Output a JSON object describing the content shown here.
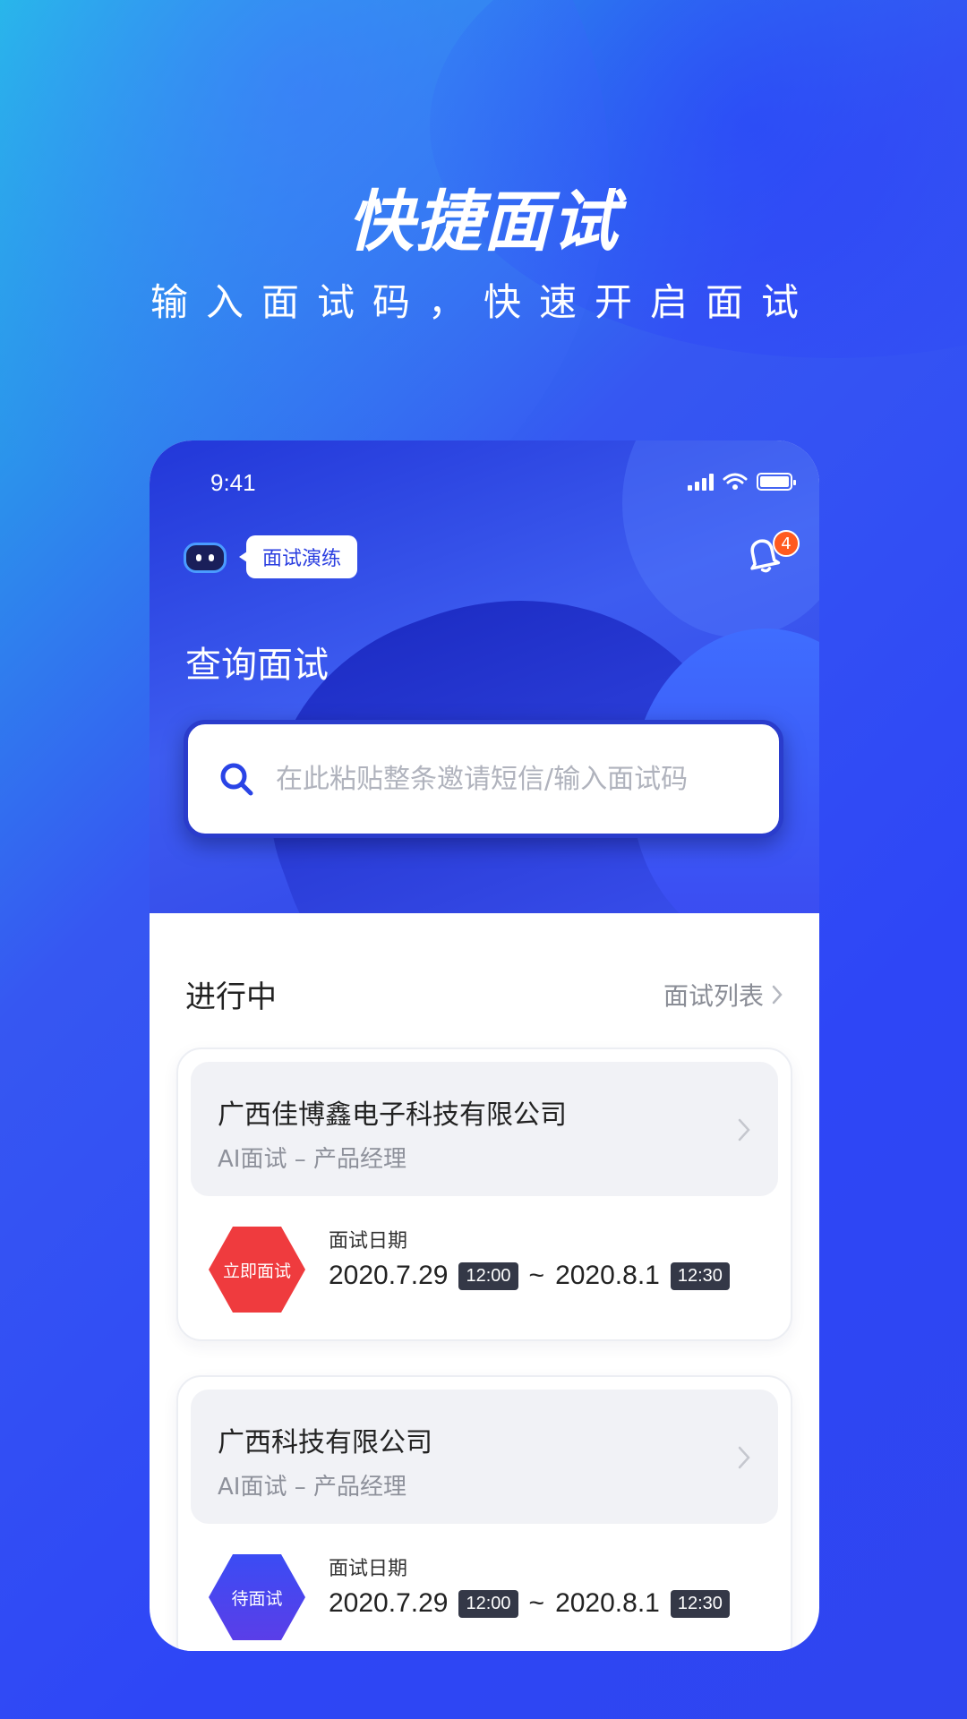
{
  "hero": {
    "title": "快捷面试",
    "subtitle": "输入面试码，快速开启面试"
  },
  "status_bar": {
    "time": "9:41"
  },
  "header": {
    "practice_label": "面试演练",
    "notification_count": "4",
    "query_title": "查询面试"
  },
  "search": {
    "placeholder": "在此粘贴整条邀请短信/输入面试码"
  },
  "section": {
    "title": "进行中",
    "list_link": "面试列表"
  },
  "cards": [
    {
      "company": "广西佳博鑫电子科技有限公司",
      "role": "AI面试 – 产品经理",
      "status": "立即面试",
      "date_label": "面试日期",
      "start_date": "2020.7.29",
      "start_time": "12:00",
      "separator": "~",
      "end_date": "2020.8.1",
      "end_time": "12:30"
    },
    {
      "company": "广西科技有限公司",
      "role": "AI面试 – 产品经理",
      "status": "待面试",
      "date_label": "面试日期",
      "start_date": "2020.7.29",
      "start_time": "12:00",
      "separator": "~",
      "end_date": "2020.8.1",
      "end_time": "12:30"
    }
  ],
  "colors": {
    "brand_blue": "#2f46f2",
    "urgent_red": "#ef3b3e",
    "badge_orange": "#ff5a1f",
    "chip_dark": "#343847"
  }
}
